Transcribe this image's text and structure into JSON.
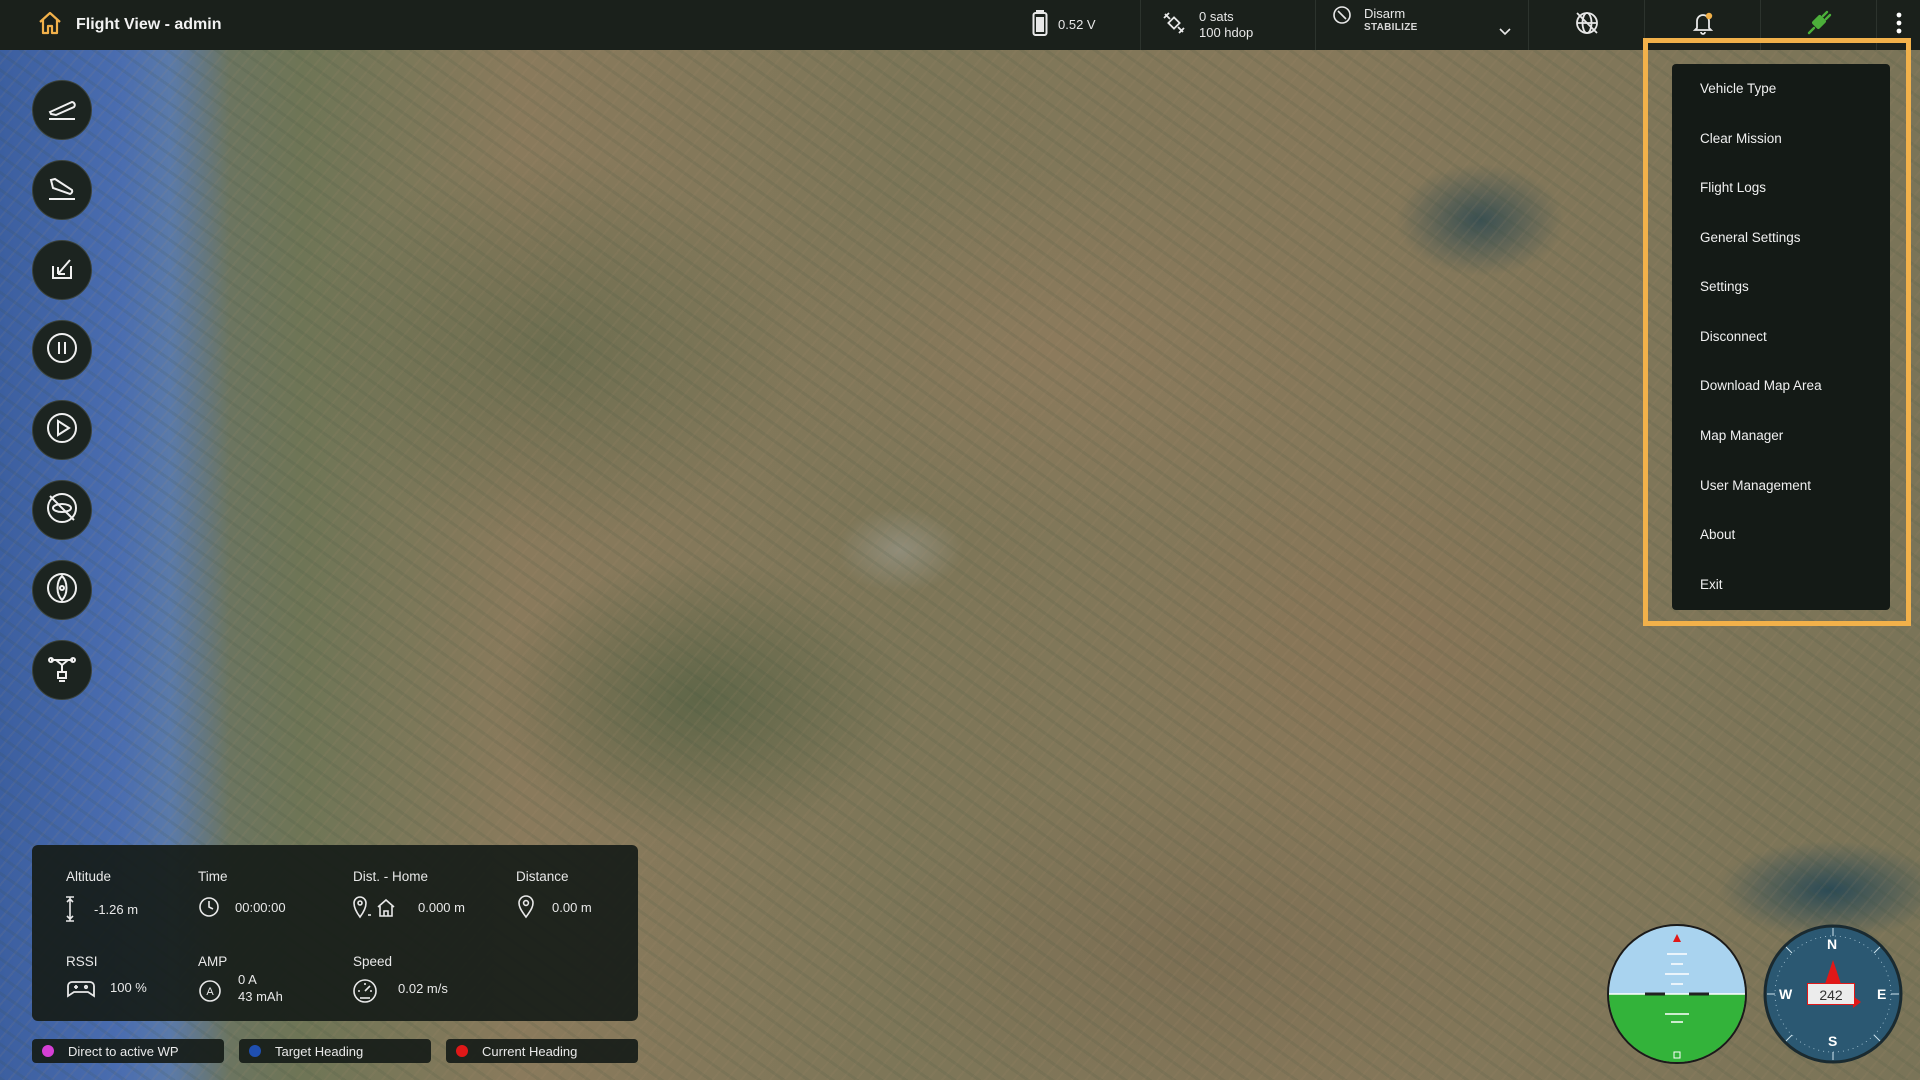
{
  "app": {
    "title": "Flight View - admin"
  },
  "status": {
    "voltage": "0.52 V",
    "sats": "0 sats",
    "hdop": "100 hdop",
    "arm_state": "Disarm",
    "flight_mode": "STABILIZE"
  },
  "menu": {
    "items": [
      "Vehicle Type",
      "Clear Mission",
      "Flight Logs",
      "General Settings",
      "Settings",
      "Disconnect",
      "Download Map Area",
      "Map Manager",
      "User Management",
      "About",
      "Exit"
    ]
  },
  "telemetry": {
    "altitude": {
      "label": "Altitude",
      "value": "-1.26 m"
    },
    "time": {
      "label": "Time",
      "value": "00:00:00"
    },
    "dist_home": {
      "label": "Dist. - Home",
      "value": "0.000 m"
    },
    "distance": {
      "label": "Distance",
      "value": "0.00 m"
    },
    "rssi": {
      "label": "RSSI",
      "value": "100 %"
    },
    "amp": {
      "label": "AMP",
      "current": "0 A",
      "capacity": "43 mAh"
    },
    "speed": {
      "label": "Speed",
      "value": "0.02 m/s"
    }
  },
  "legend": [
    {
      "label": "Direct to active WP",
      "color": "#d63fd6"
    },
    {
      "label": "Target Heading",
      "color": "#1f4fb0"
    },
    {
      "label": "Current Heading",
      "color": "#e01818"
    }
  ],
  "compass": {
    "heading": "242",
    "n": "N",
    "e": "E",
    "s": "S",
    "w": "W"
  },
  "colors": {
    "accent": "#f2b14a",
    "connected": "#4caf3a"
  }
}
